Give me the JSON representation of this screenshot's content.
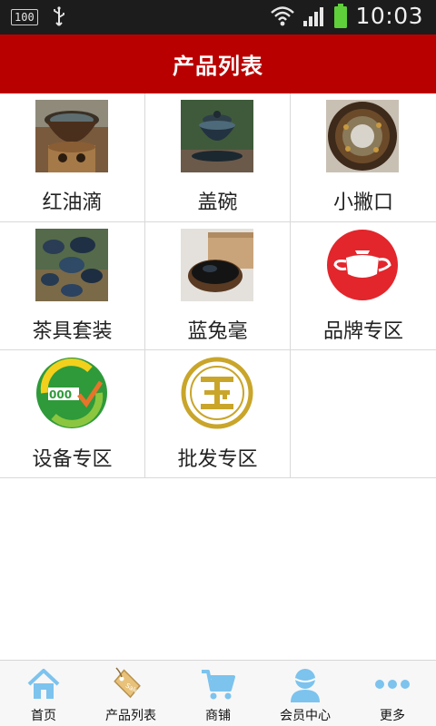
{
  "status_bar": {
    "battery_text": "100",
    "time": "10:03"
  },
  "header": {
    "title": "产品列表"
  },
  "products": [
    {
      "label": "红油滴",
      "icon": "oil-drop-teacup-photo"
    },
    {
      "label": "盖碗",
      "icon": "lidded-bowl-photo"
    },
    {
      "label": "小撇口",
      "icon": "flared-rim-cup-photo"
    },
    {
      "label": "茶具套装",
      "icon": "tea-set-photo"
    },
    {
      "label": "蓝兔毫",
      "icon": "blue-hare-fur-cup-photo"
    },
    {
      "label": "品牌专区",
      "icon": "teapot-icon"
    },
    {
      "label": "设备专区",
      "icon": "equipment-logo-icon"
    },
    {
      "label": "批发专区",
      "icon": "wholesale-coin-icon"
    }
  ],
  "colors": {
    "header_bg": "#b90000",
    "status_bg": "#1c1c1c",
    "tab_icon": "#7cc3ee",
    "brand_red": "#e2262c",
    "gold": "#c9a52a"
  },
  "tab_bar": {
    "tabs": [
      {
        "label": "首页",
        "icon": "home-icon"
      },
      {
        "label": "产品列表",
        "icon": "price-tag-icon"
      },
      {
        "label": "商铺",
        "icon": "shopping-cart-icon"
      },
      {
        "label": "会员中心",
        "icon": "user-icon"
      },
      {
        "label": "更多",
        "icon": "more-dots-icon"
      }
    ]
  }
}
